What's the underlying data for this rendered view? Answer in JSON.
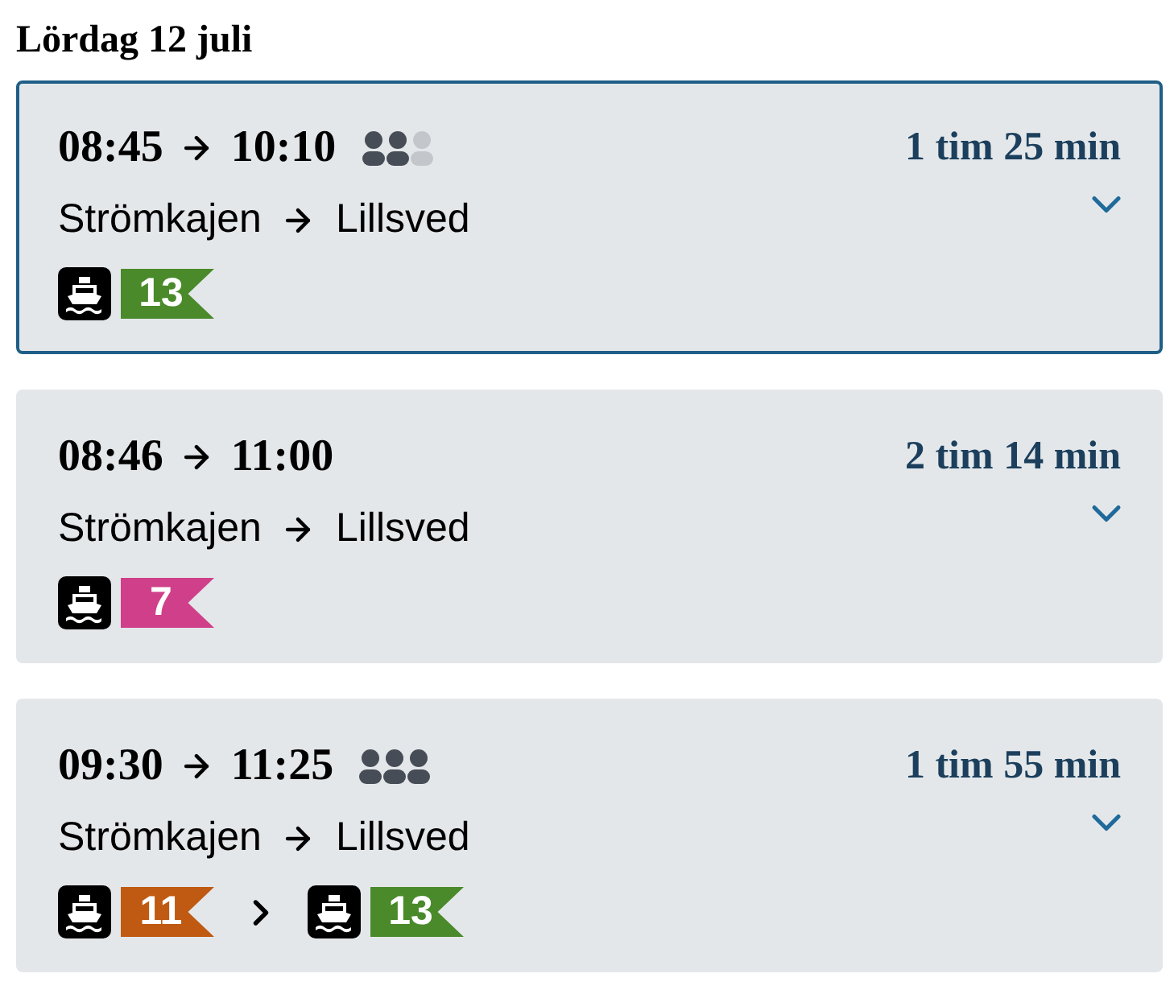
{
  "date_heading": "Lördag 12 juli",
  "trips": [
    {
      "selected": true,
      "depart": "08:45",
      "arrive": "10:10",
      "kind": "moderate",
      "duration": "1 tim 25 min",
      "from": "Strömkajen",
      "to": "Lillsved",
      "legs": [
        {
          "kind": "ferry",
          "line": "13",
          "color": "#4a8a2a"
        }
      ]
    },
    {
      "selected": false,
      "kind": "plain",
      "depart": "08:46",
      "arrive": "11:00",
      "duration": "2 tim 14 min",
      "from": "Strömkajen",
      "to": "Lillsved",
      "legs": [
        {
          "kind": "ferry",
          "line": "7",
          "color": "#d0408a"
        }
      ]
    },
    {
      "selected": false,
      "depart": "09:30",
      "arrive": "11:25",
      "kind": "crowded",
      "duration": "1 tim 55 min",
      "from": "Strömkajen",
      "to": "Lillsved",
      "legs": [
        {
          "kind": "ferry",
          "line": "11",
          "color": "#c05a12"
        },
        {
          "kind": "ferry",
          "line": "13",
          "color": "#4a8a2a"
        }
      ]
    }
  ]
}
